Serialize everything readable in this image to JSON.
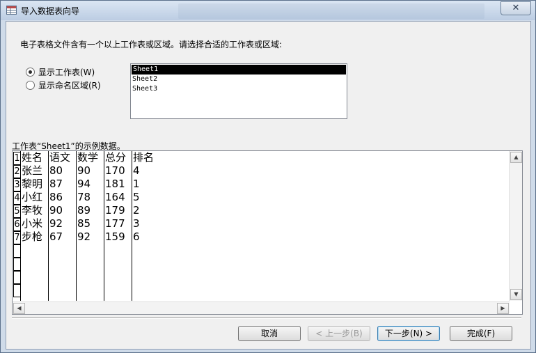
{
  "window": {
    "title": "导入数据表向导",
    "close_glyph": "✕"
  },
  "intro_text": "电子表格文件含有一个以上工作表或区域。请选择合适的工作表或区域:",
  "options": [
    {
      "label": "显示工作表(W)",
      "selected": true
    },
    {
      "label": "显示命名区域(R)",
      "selected": false
    }
  ],
  "sheets": [
    "Sheet1",
    "Sheet2",
    "Sheet3"
  ],
  "selected_sheet": "Sheet1",
  "sample_label": "工作表“Sheet1”的示例数据。",
  "table": {
    "row_numbers": [
      "1",
      "2",
      "3",
      "4",
      "5",
      "6",
      "7"
    ],
    "headers": [
      "姓名",
      "语文",
      "数学",
      "总分",
      "排名"
    ],
    "rows": [
      [
        "张兰",
        "80",
        "90",
        "170",
        "4"
      ],
      [
        "黎明",
        "87",
        "94",
        "181",
        "1"
      ],
      [
        "小红",
        "86",
        "78",
        "164",
        "5"
      ],
      [
        "李牧",
        "90",
        "89",
        "179",
        "2"
      ],
      [
        "小米",
        "92",
        "85",
        "177",
        "3"
      ],
      [
        "步枪",
        "67",
        "92",
        "159",
        "6"
      ]
    ]
  },
  "buttons": {
    "cancel": "取消",
    "back": "< 上一步(B)",
    "next": "下一步(N) >",
    "finish": "完成(F)"
  },
  "scroll_glyphs": {
    "up": "▲",
    "down": "▼",
    "left": "◀",
    "right": "▶"
  }
}
